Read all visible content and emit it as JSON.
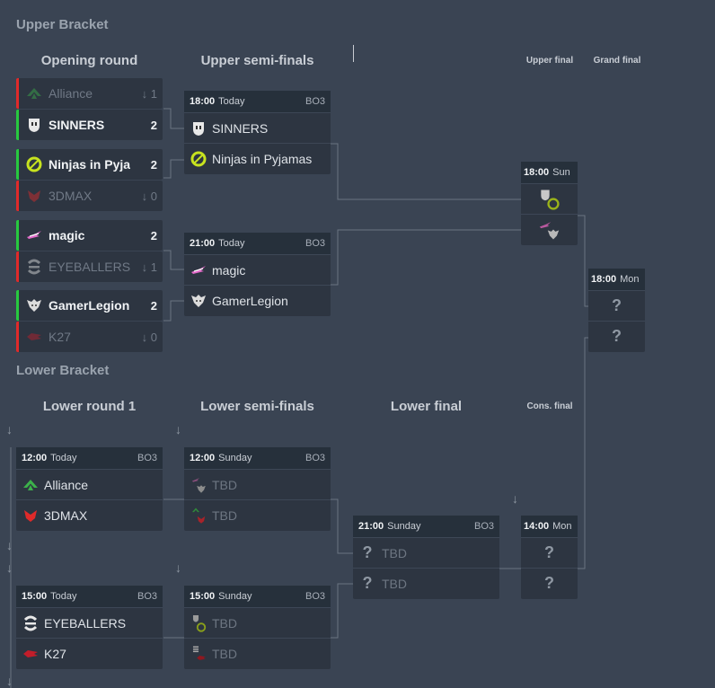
{
  "sections": {
    "upper": "Upper Bracket",
    "lower": "Lower Bracket"
  },
  "rounds": {
    "opening": "Opening round",
    "upper_semis": "Upper semi-finals",
    "upper_final": "Upper final",
    "grand_final": "Grand final",
    "lower_r1": "Lower round 1",
    "lower_semis": "Lower semi-finals",
    "lower_final": "Lower final",
    "cons_final": "Cons. final"
  },
  "opening": [
    {
      "team": "Alliance",
      "score": "1",
      "result": "loss",
      "logo": "alliance-logo",
      "elim": "↓"
    },
    {
      "team": "SINNERS",
      "score": "2",
      "result": "win",
      "logo": "sinners-logo"
    },
    {
      "team": "Ninjas in Pyja...",
      "score": "2",
      "result": "win",
      "logo": "nip-logo"
    },
    {
      "team": "3DMAX",
      "score": "0",
      "result": "loss",
      "logo": "3dmax-logo",
      "elim": "↓"
    },
    {
      "team": "magic",
      "score": "2",
      "result": "win",
      "logo": "magic-logo"
    },
    {
      "team": "EYEBALLERS",
      "score": "1",
      "result": "loss",
      "logo": "eyeballers-logo",
      "elim": "↓"
    },
    {
      "team": "GamerLegion",
      "score": "2",
      "result": "win",
      "logo": "gamerlegion-logo"
    },
    {
      "team": "K27",
      "score": "0",
      "result": "loss",
      "logo": "k27-logo",
      "elim": "↓"
    }
  ],
  "matches": {
    "us1": {
      "time": "18:00",
      "day": "Today",
      "bo": "BO3",
      "team1": "SINNERS",
      "team2": "Ninjas in Pyjamas"
    },
    "us2": {
      "time": "21:00",
      "day": "Today",
      "bo": "BO3",
      "team1": "magic",
      "team2": "GamerLegion"
    },
    "uf": {
      "time": "18:00",
      "day": "Sun"
    },
    "gf": {
      "time": "18:00",
      "day": "Mon",
      "q1": "?",
      "q2": "?"
    },
    "lr1a": {
      "time": "12:00",
      "day": "Today",
      "bo": "BO3",
      "team1": "Alliance",
      "team2": "3DMAX"
    },
    "lr1b": {
      "time": "15:00",
      "day": "Today",
      "bo": "BO3",
      "team1": "EYEBALLERS",
      "team2": "K27"
    },
    "ls1": {
      "time": "12:00",
      "day": "Sunday",
      "bo": "BO3",
      "team1": "TBD",
      "team2": "TBD"
    },
    "ls2": {
      "time": "15:00",
      "day": "Sunday",
      "bo": "BO3",
      "team1": "TBD",
      "team2": "TBD"
    },
    "lf": {
      "time": "21:00",
      "day": "Sunday",
      "bo": "BO3",
      "team1": "TBD",
      "team2": "TBD",
      "q": "?"
    },
    "cf": {
      "time": "14:00",
      "day": "Mon",
      "q1": "?",
      "q2": "?"
    }
  },
  "arrow": "↓",
  "colors": {
    "background": "#3a4453",
    "card": "#2d3541",
    "win": "#27c93f",
    "loss": "#e02a2a"
  }
}
